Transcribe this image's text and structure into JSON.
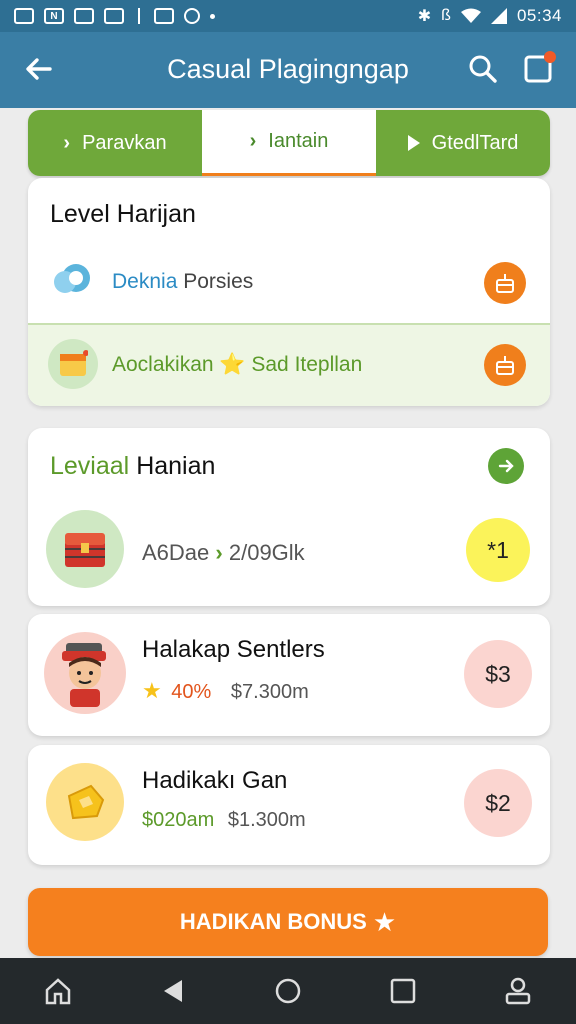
{
  "status_bar": {
    "time": "05:34",
    "icons": [
      "image-icon",
      "n-icon",
      "photo-icon",
      "chart-icon",
      "security-icon",
      "record-icon",
      "bluetooth-icon",
      "vibrate-icon",
      "wifi-icon",
      "signal-icon"
    ]
  },
  "app_bar": {
    "title": "Casual Plagingngap",
    "icons": [
      "back-arrow-icon",
      "search-icon",
      "notification-icon"
    ]
  },
  "tabs": [
    {
      "label": "Paravkan",
      "icon": "chevron-right-icon",
      "active": false
    },
    {
      "label": "Iantain",
      "icon": "chevron-right-icon",
      "active": true
    },
    {
      "label": "GtedlTard",
      "icon": "play-icon",
      "active": false
    }
  ],
  "card1": {
    "heading": "Level Harijan",
    "rows": [
      {
        "label": "Deknia Porsies",
        "label_part1": "Deknia",
        "label_part2": "Porsies",
        "icon": "chat-bubble-icon",
        "action_icon": "gift-box-icon"
      },
      {
        "label": "Aoclakikan ⭐ Sad Itepllan",
        "icon": "calendar-icon",
        "action_icon": "gift-box-icon"
      }
    ]
  },
  "card2": {
    "heading_part1": "Leviaal",
    "heading_part2": "Hanian",
    "item": {
      "text1": "A6Dae",
      "text2": "›",
      "text3": "2/09Glk",
      "badge": "*1",
      "icon": "treasure-chest-icon"
    }
  },
  "card3": {
    "title": "Halakap Sentlers",
    "percent": "40%",
    "amount": "$7.300m",
    "badge": "$3",
    "icon": "character-avatar-icon"
  },
  "card4": {
    "title": "Hadikakı Gan",
    "amount_green": "$020am",
    "amount": "$1.300m",
    "badge": "$2",
    "icon": "gold-coin-icon"
  },
  "bonus_button": {
    "label": "HADIKAN BONUS",
    "icon": "star-icon"
  },
  "nav_bar": {
    "icons": [
      "home-icon",
      "back-icon",
      "circle-home-icon",
      "recents-icon",
      "profile-icon"
    ]
  },
  "colors": {
    "app_bar": "#3a7ea5",
    "green": "#6fa83a",
    "orange": "#f07f1c",
    "yellow_badge": "#fbf35a",
    "pink_badge": "#fbd5d0"
  }
}
